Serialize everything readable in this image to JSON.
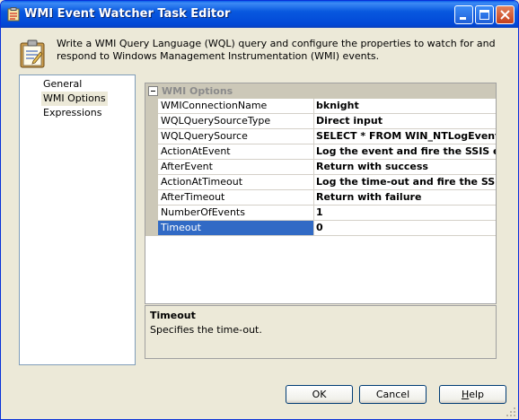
{
  "window": {
    "title": "WMI Event Watcher Task Editor"
  },
  "description": "Write a WMI Query Language (WQL) query and configure the properties to watch for and respond to Windows Management Instrumentation (WMI) events.",
  "nav": {
    "items": [
      {
        "label": "General",
        "selected": false
      },
      {
        "label": "WMI Options",
        "selected": true
      },
      {
        "label": "Expressions",
        "selected": false
      }
    ]
  },
  "grid": {
    "category": "WMI Options",
    "rows": [
      {
        "name": "WMIConnectionName",
        "value": "bknight"
      },
      {
        "name": "WQLQuerySourceType",
        "value": "Direct input"
      },
      {
        "name": "WQLQuerySource",
        "value": "SELECT * FROM WIN_NTLogEvent Wh"
      },
      {
        "name": "ActionAtEvent",
        "value": "Log the event and fire the SSIS even"
      },
      {
        "name": "AfterEvent",
        "value": "Return with success"
      },
      {
        "name": "ActionAtTimeout",
        "value": "Log the time-out and fire the SSIS e"
      },
      {
        "name": "AfterTimeout",
        "value": "Return with failure"
      },
      {
        "name": "NumberOfEvents",
        "value": "1"
      },
      {
        "name": "Timeout",
        "value": "0"
      }
    ],
    "selected_row": "Timeout"
  },
  "help": {
    "title": "Timeout",
    "text": "Specifies the time-out."
  },
  "buttons": {
    "ok": "OK",
    "cancel": "Cancel",
    "help_mnemonic": "H",
    "help_rest": "elp"
  },
  "colors": {
    "titlebar": "#0858df",
    "selection": "#316ac5",
    "face": "#ece9d8"
  }
}
